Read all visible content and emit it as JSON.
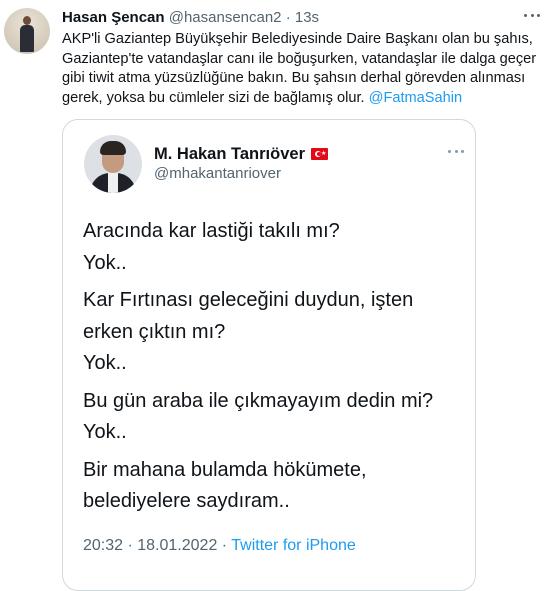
{
  "tweet": {
    "display_name": "Hasan Şencan",
    "handle": "@hasansencan2",
    "separator": "·",
    "time": "13s",
    "text_lines": [
      "AKP'li Gaziantep Büyükşehir Belediyesinde Daire Başkanı olan bu şahıs,",
      "Gaziantep'te vatandaşlar canı ile boğuşurken, vatandaşlar ile dalga geçer",
      "gibi tiwit atma yüzsüzlüğüne bakın. Bu şahsın derhal görevden alınması"
    ],
    "text_last_line": "gerek, yoksa bu cümleler sizi de bağlamış olur.",
    "mention": "@FatmaSahin"
  },
  "quoted": {
    "display_name": "M. Hakan Tanrıöver",
    "handle": "@mhakantanriover",
    "paragraphs": [
      [
        "Aracında kar lastiği takılı mı?",
        "Yok.."
      ],
      [
        "Kar Fırtınası geleceğini duydun, işten",
        "erken çıktın mı?",
        "Yok.."
      ],
      [
        "Bu gün araba ile çıkmayayım dedin mi?",
        "Yok.."
      ],
      [
        "Bir mahana bulamda hökümete,",
        "belediyelere saydıram.."
      ]
    ],
    "timestamp": "20:32 · 18.01.2022 ·",
    "source": "Twitter for iPhone"
  },
  "icons": {
    "more": "more-horizontal-icon",
    "flag": "turkey-flag-icon"
  },
  "colors": {
    "link": "#1d9bf0",
    "secondary_text": "#536471",
    "border": "#cfd9de"
  }
}
